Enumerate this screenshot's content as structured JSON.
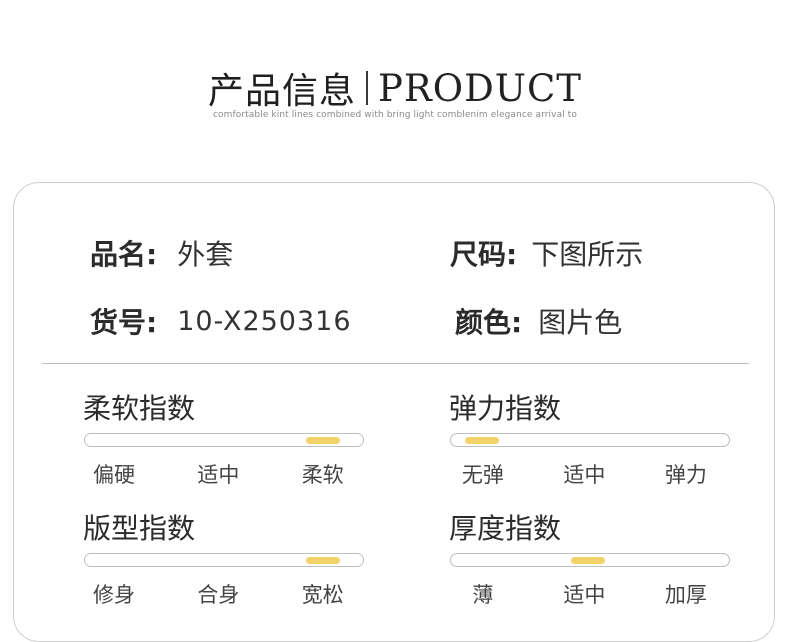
{
  "header": {
    "title_cn": "产品信息",
    "title_en": "PRODUCT",
    "subtitle": "comfortable kint lines combined with bring light comblenim elegance arrival to"
  },
  "info": {
    "name": {
      "label": "品名:",
      "value": "外套"
    },
    "size": {
      "label": "尺码:",
      "value": "下图所示"
    },
    "item_no": {
      "label": "货号:",
      "value": "10-X250316"
    },
    "color": {
      "label": "颜色:",
      "value": "图片色"
    }
  },
  "metrics": {
    "softness": {
      "title": "柔软指数",
      "scale": [
        "偏硬",
        "适中",
        "柔软"
      ],
      "level": 0.85
    },
    "elasticity": {
      "title": "弹力指数",
      "scale": [
        "无弹",
        "适中",
        "弹力"
      ],
      "level": 0.11
    },
    "fit": {
      "title": "版型指数",
      "scale": [
        "修身",
        "合身",
        "宽松"
      ],
      "level": 0.85
    },
    "thickness": {
      "title": "厚度指数",
      "scale": [
        "薄",
        "适中",
        "加厚"
      ],
      "level": 0.49
    }
  },
  "colors": {
    "indicator": "#f3d26a",
    "border": "#cfcfcf"
  }
}
